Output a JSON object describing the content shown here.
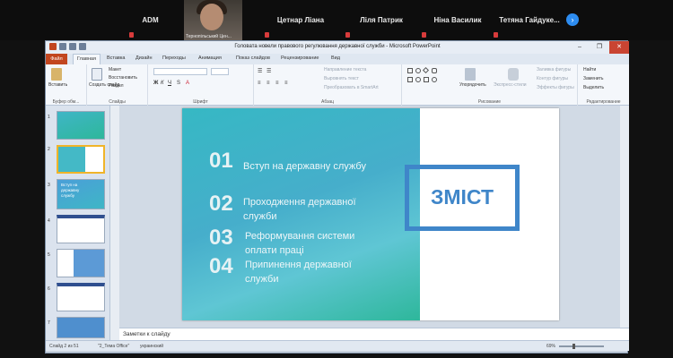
{
  "meeting": {
    "participants": [
      {
        "name": "ADM"
      },
      {
        "name": "Цетнар Ліана"
      },
      {
        "name": "Ліля Патрик"
      },
      {
        "name": "Ніна Василик"
      },
      {
        "name": "Тетяна Гайдуке..."
      }
    ],
    "active_speaker_label": "Тернопільський Цен...",
    "next_icon": "chevron-right-icon"
  },
  "window": {
    "title": "Головата новели правового регулювання державної служби - Microsoft PowerPoint"
  },
  "tabs": [
    "Файл",
    "Главная",
    "Вставка",
    "Дизайн",
    "Переходы",
    "Анимация",
    "Показ слайдов",
    "Рецензирование",
    "Вид"
  ],
  "ribbon": {
    "paste": "Вставить",
    "new_slide": "Создать слайд",
    "layout": "Макет",
    "reset": "Восстановить",
    "section": "Раздел",
    "clipboard": "Буфер обм...",
    "slides": "Слайды",
    "font": "Шрифт",
    "paragraph": "Абзац",
    "text_direction": "Направление текста",
    "align_text": "Выровнять текст",
    "smartart": "Преобразовать в SmartArt",
    "arrange": "Упорядочить",
    "quick_styles": "Экспресс-стили",
    "fill": "Заливка фигуры",
    "outline": "Контур фигуры",
    "effects": "Эффекты фигуры",
    "drawing": "Рисование",
    "find": "Найти",
    "replace": "Заменить",
    "select": "Выделить",
    "editing": "Редактирование"
  },
  "slide": {
    "items": [
      {
        "num": "01",
        "text": "Вступ на державну службу"
      },
      {
        "num": "02",
        "text1": "Проходження державної",
        "text2": "служби"
      },
      {
        "num": "03",
        "text1": "Реформування системи",
        "text2": "оплати праці"
      },
      {
        "num": "04",
        "text1": "Припинення державної",
        "text2": "служби"
      }
    ],
    "title": "ЗМІСТ"
  },
  "thumbs": {
    "nums": [
      "1",
      "2",
      "3",
      "4",
      "5",
      "6",
      "7"
    ],
    "t3_text1": "Вступ на",
    "t3_text2": "державну",
    "t3_text3": "службу"
  },
  "notes_placeholder": "Заметки к слайду",
  "status": {
    "slide": "Слайд 2 из 51",
    "theme": "\"2_Тема Office\"",
    "lang": "украинский",
    "zoom": "69%",
    "zoom_level": 0.69
  },
  "colors": {
    "accent_teal": "#36b8c4",
    "accent_blue": "#3f86c9",
    "file_tab": "#c2461f"
  }
}
